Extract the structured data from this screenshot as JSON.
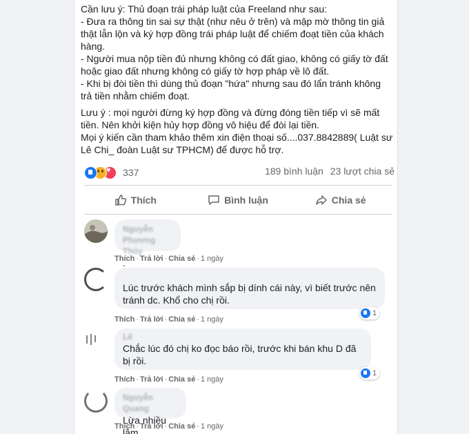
{
  "post": {
    "paragraphs": [
      "Cần lưu ý: Thủ đoạn trái pháp luật của Freeland như sau:",
      "- Đưa ra thông tin sai sự thật (như nêu ở trên) và mập mờ thông tin giả thật lẫn lộn và ký hợp đồng trái pháp luật để chiếm đoạt tiền của khách hàng.",
      "- Người mua nộp tiền đủ nhưng không có đất giao, không có giấy tờ đất hoặc giao đất nhưng không có giấy tờ hợp pháp về lô đất.",
      "- Khi bị đòi tiền thì dùng thủ đoạn \"hứa\" nhưng sau đó lẩn tránh không trả tiền nhằm chiếm đoạt.",
      "Lưu ý : mọi người đừng ký hợp đồng và đừng đóng tiền tiếp vì sẽ mất tiền. Nên khởi kiện hủy hợp đồng vô hiệu để đòi lại tiền.",
      "Mọi ý kiến cần tham khảo thêm xin điện thoại số....037.8842889( Luật sư Lê Chi_ đoàn Luật sư TPHCM)  để được hỗ trợ."
    ]
  },
  "stats": {
    "reaction_count": "337",
    "comments": "189 bình luận",
    "shares": "23 lượt chia sẻ"
  },
  "actions": {
    "like": "Thích",
    "comment": "Bình luận",
    "share": "Chia sẻ"
  },
  "comment_meta": {
    "like": "Thích",
    "reply": "Trả lời",
    "share": "Chia sẻ",
    "sep": "·"
  },
  "comments": [
    {
      "author": "Nguyễn Phương Thủy",
      "text": ".",
      "time": "1 ngày",
      "likes": ""
    },
    {
      "author": "",
      "text": "Lúc trước khách mình sắp bị dính cái này, vì biết trước nên tránh dc. Khổ cho chị rồi.",
      "time": "1 ngày",
      "likes": "1"
    },
    {
      "author": "Lê",
      "text": "Chắc lúc đó chị ko đọc báo rồi, trước khi bán khu D đã bị rồi.",
      "time": "1 ngày",
      "likes": "1"
    },
    {
      "author": "Nguyễn Quang",
      "text": "Lừa nhiều lắm",
      "time": "1 ngày",
      "likes": ""
    }
  ],
  "colors": {
    "page_bg": "#f0f2f5",
    "card_bg": "#ffffff",
    "text": "#1c1e21",
    "muted": "#65676b",
    "like_blue": "#1877f2"
  }
}
